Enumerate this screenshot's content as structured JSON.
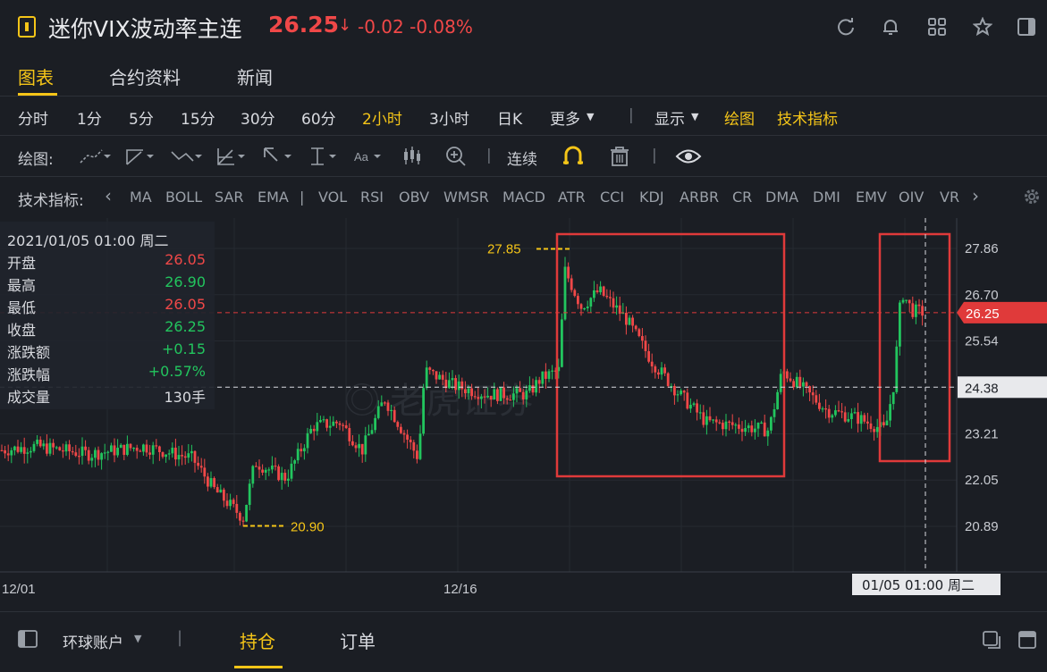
{
  "header": {
    "title": "迷你VIX波动率主连",
    "price": "26.25",
    "arrow": "↓",
    "change": "-0.02",
    "change_pct": "-0.08%",
    "icons": [
      "refresh-icon",
      "bell-icon",
      "grid-icon",
      "star-icon",
      "sidebar-icon"
    ]
  },
  "tabs": [
    "图表",
    "合约资料",
    "新闻"
  ],
  "periods": [
    "分时",
    "1分",
    "5分",
    "15分",
    "30分",
    "60分",
    "2小时",
    "3小时",
    "日K",
    "更多",
    "|",
    "显示",
    "绘图",
    "技术指标"
  ],
  "active_period": "2小时",
  "draw_toolbar": {
    "label": "绘图:",
    "continuous": "连续",
    "separator": "|"
  },
  "indicators": {
    "label": "技术指标:",
    "items": [
      "MA",
      "BOLL",
      "SAR",
      "EMA",
      "|",
      "VOL",
      "RSI",
      "OBV",
      "WMSR",
      "MACD",
      "ATR",
      "CCI",
      "KDJ",
      "ARBR",
      "CR",
      "DMA",
      "DMI",
      "EMV",
      "OIV",
      "VR"
    ]
  },
  "info_panel": {
    "datetime": "2021/01/05 01:00 周二",
    "rows": [
      {
        "label": "开盘",
        "value": "26.05",
        "color": "#f04848"
      },
      {
        "label": "最高",
        "value": "26.90",
        "color": "#22c55e"
      },
      {
        "label": "最低",
        "value": "26.05",
        "color": "#f04848"
      },
      {
        "label": "收盘",
        "value": "26.25",
        "color": "#22c55e"
      },
      {
        "label": "涨跌额",
        "value": "+0.15",
        "color": "#22c55e"
      },
      {
        "label": "涨跌幅",
        "value": "+0.57%",
        "color": "#22c55e"
      },
      {
        "label": "成交量",
        "value": "130手",
        "color": "#d8dadf"
      }
    ]
  },
  "chart_data": {
    "type": "candlestick",
    "y_ticks": [
      "27.86",
      "26.70",
      "25.54",
      "24.38",
      "23.21",
      "22.05",
      "20.89"
    ],
    "x_ticks": [
      "12/01",
      "12/16"
    ],
    "high_annotation": "27.85",
    "low_annotation": "20.90",
    "current_price": "26.25",
    "crosshair_price": "24.38",
    "crosshair_time": "01/05 01:00 周二",
    "up_color": "#22c55e",
    "down_color": "#f04848"
  },
  "bottom": {
    "account": "环球账户",
    "tabs": [
      "持仓",
      "订单"
    ]
  }
}
